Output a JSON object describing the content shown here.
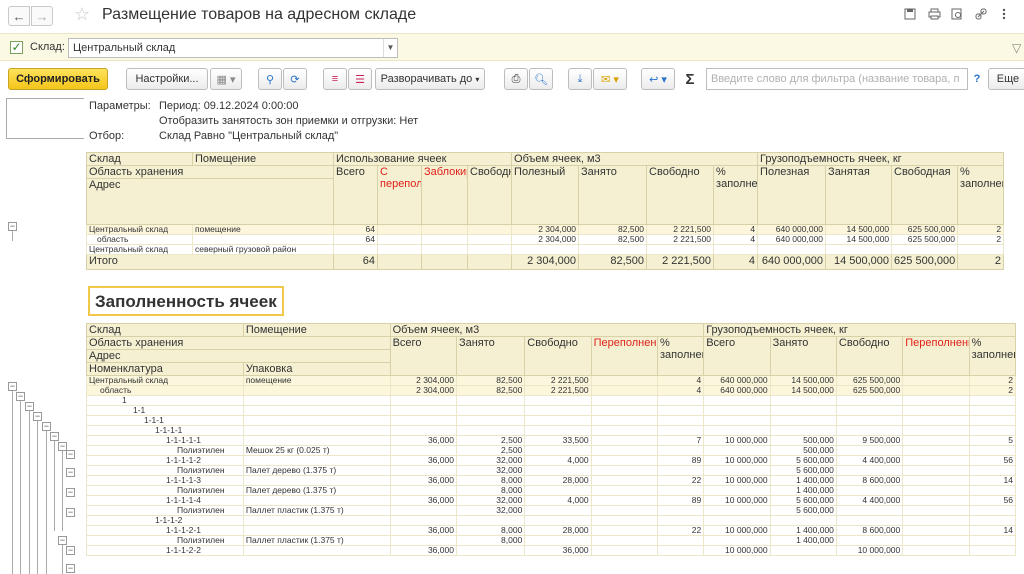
{
  "window": {
    "title": "Размещение товаров на адресном складе",
    "back_icon": "←",
    "forward_icon": "→",
    "star_icon": "☆"
  },
  "filter": {
    "warehouse_label": "Склад:",
    "warehouse_value": "Центральный склад",
    "checked": true
  },
  "toolbar": {
    "generate_label": "Сформировать",
    "settings_label": "Настройки...",
    "expand_label": "Разворачивать до",
    "search_placeholder": "Введите слово для фильтра (название товара, п",
    "help_label": "?",
    "more_label": "Еще"
  },
  "params": {
    "parameters_label": "Параметры:",
    "period": "Период: 09.12.2024 0:00:00",
    "show_zones": "Отобразить занятость зон приемки и отгрузки: Нет",
    "selection_label": "Отбор:",
    "selection_value": "Склад Равно \"Центральный склад\""
  },
  "table1": {
    "h_warehouse": "Склад",
    "h_room": "Помещение",
    "h_cells_use": "Использование ячеек",
    "h_volume": "Объем ячеек, м3",
    "h_capacity": "Грузоподъемность ячеек, кг",
    "h_storage_area": "Область хранения",
    "h_address": "Адрес",
    "h_total": "Всего",
    "h_overfilled": "С переполнением",
    "h_blocked": "Заблокировано",
    "h_free_cells": "Свободных",
    "h_useful": "Полезный",
    "h_occupied": "Занято",
    "h_free": "Свободно",
    "h_percent": "% заполнения",
    "h_useful_cap": "Полезная",
    "h_occupied_cap": "Занятая",
    "h_free_cap": "Свободная",
    "rows": [
      {
        "name": "Центральный склад",
        "room": "помещение",
        "total": "64",
        "useful": "2 304,000",
        "occupied": "82,500",
        "free": "2 221,500",
        "pct": "4",
        "cap_useful": "640 000,000",
        "cap_occ": "14 500,000",
        "cap_free": "625 500,000",
        "cap_pct": "2"
      },
      {
        "name": "область",
        "room": "",
        "total": "64",
        "useful": "2 304,000",
        "occupied": "82,500",
        "free": "2 221,500",
        "pct": "4",
        "cap_useful": "640 000,000",
        "cap_occ": "14 500,000",
        "cap_free": "625 500,000",
        "cap_pct": "2"
      },
      {
        "name": "Центральный склад",
        "room": "северный грузовой район",
        "total": "",
        "useful": "",
        "occupied": "",
        "free": "",
        "pct": "",
        "cap_useful": "",
        "cap_occ": "",
        "cap_free": "",
        "cap_pct": ""
      }
    ],
    "total_row": {
      "label": "Итого",
      "total": "64",
      "useful": "2 304,000",
      "occupied": "82,500",
      "free": "2 221,500",
      "pct": "4",
      "cap_useful": "640 000,000",
      "cap_occ": "14 500,000",
      "cap_free": "625 500,000",
      "cap_pct": "2"
    }
  },
  "section_title": "Заполненность ячеек",
  "table2": {
    "h_warehouse": "Склад",
    "h_room": "Помещение",
    "h_volume": "Объем ячеек, м3",
    "h_capacity": "Грузоподъемность ячеек, кг",
    "h_storage_area": "Область хранения",
    "h_address": "Адрес",
    "h_nomenclature": "Номенклатура",
    "h_package": "Упаковка",
    "h_total": "Всего",
    "h_occupied": "Занято",
    "h_free": "Свободно",
    "h_overfill": "Переполнение",
    "h_percent": "% заполнения",
    "rows": [
      {
        "a": "Центральный склад",
        "b": "помещение",
        "indent": 0,
        "v_total": "2 304,000",
        "v_occ": "82,500",
        "v_free": "2 221,500",
        "v_pct": "4",
        "c_total": "640 000,000",
        "c_occ": "14 500,000",
        "c_free": "625 500,000",
        "c_pct": "2",
        "group": true
      },
      {
        "a": "область",
        "b": "",
        "indent": 1,
        "v_total": "2 304,000",
        "v_occ": "82,500",
        "v_free": "2 221,500",
        "v_pct": "4",
        "c_total": "640 000,000",
        "c_occ": "14 500,000",
        "c_free": "625 500,000",
        "c_pct": "2",
        "group": true
      },
      {
        "a": "1",
        "b": "",
        "indent": 3,
        "v_total": "",
        "v_occ": "",
        "v_free": "",
        "v_pct": "",
        "c_total": "",
        "c_occ": "",
        "c_free": "",
        "c_pct": ""
      },
      {
        "a": "1-1",
        "b": "",
        "indent": 4,
        "v_total": "",
        "v_occ": "",
        "v_free": "",
        "v_pct": "",
        "c_total": "",
        "c_occ": "",
        "c_free": "",
        "c_pct": ""
      },
      {
        "a": "1-1-1",
        "b": "",
        "indent": 5,
        "v_total": "",
        "v_occ": "",
        "v_free": "",
        "v_pct": "",
        "c_total": "",
        "c_occ": "",
        "c_free": "",
        "c_pct": ""
      },
      {
        "a": "1-1-1-1",
        "b": "",
        "indent": 6,
        "v_total": "",
        "v_occ": "",
        "v_free": "",
        "v_pct": "",
        "c_total": "",
        "c_occ": "",
        "c_free": "",
        "c_pct": ""
      },
      {
        "a": "1-1-1-1-1",
        "b": "",
        "indent": 7,
        "v_total": "36,000",
        "v_occ": "2,500",
        "v_free": "33,500",
        "v_pct": "7",
        "c_total": "10 000,000",
        "c_occ": "500,000",
        "c_free": "9 500,000",
        "c_pct": "5"
      },
      {
        "a": "Полиэтилен",
        "b": "Мешок 25 кг (0.025 т)",
        "indent": 8,
        "v_total": "",
        "v_occ": "2,500",
        "v_free": "",
        "v_pct": "",
        "c_total": "",
        "c_occ": "500,000",
        "c_free": "",
        "c_pct": ""
      },
      {
        "a": "1-1-1-1-2",
        "b": "",
        "indent": 7,
        "v_total": "36,000",
        "v_occ": "32,000",
        "v_free": "4,000",
        "v_pct": "89",
        "c_total": "10 000,000",
        "c_occ": "5 600,000",
        "c_free": "4 400,000",
        "c_pct": "56"
      },
      {
        "a": "Полиэтилен",
        "b": "Палет дерево (1.375 т)",
        "indent": 8,
        "v_total": "",
        "v_occ": "32,000",
        "v_free": "",
        "v_pct": "",
        "c_total": "",
        "c_occ": "5 600,000",
        "c_free": "",
        "c_pct": ""
      },
      {
        "a": "1-1-1-1-3",
        "b": "",
        "indent": 7,
        "v_total": "36,000",
        "v_occ": "8,000",
        "v_free": "28,000",
        "v_pct": "22",
        "c_total": "10 000,000",
        "c_occ": "1 400,000",
        "c_free": "8 600,000",
        "c_pct": "14"
      },
      {
        "a": "Полиэтилен",
        "b": "Палет дерево (1.375 т)",
        "indent": 8,
        "v_total": "",
        "v_occ": "8,000",
        "v_free": "",
        "v_pct": "",
        "c_total": "",
        "c_occ": "1 400,000",
        "c_free": "",
        "c_pct": ""
      },
      {
        "a": "1-1-1-1-4",
        "b": "",
        "indent": 7,
        "v_total": "36,000",
        "v_occ": "32,000",
        "v_free": "4,000",
        "v_pct": "89",
        "c_total": "10 000,000",
        "c_occ": "5 600,000",
        "c_free": "4 400,000",
        "c_pct": "56"
      },
      {
        "a": "Полиэтилен",
        "b": "Паллет пластик (1.375 т)",
        "indent": 8,
        "v_total": "",
        "v_occ": "32,000",
        "v_free": "",
        "v_pct": "",
        "c_total": "",
        "c_occ": "5 600,000",
        "c_free": "",
        "c_pct": ""
      },
      {
        "a": "1-1-1-2",
        "b": "",
        "indent": 6,
        "v_total": "",
        "v_occ": "",
        "v_free": "",
        "v_pct": "",
        "c_total": "",
        "c_occ": "",
        "c_free": "",
        "c_pct": ""
      },
      {
        "a": "1-1-1-2-1",
        "b": "",
        "indent": 7,
        "v_total": "36,000",
        "v_occ": "8,000",
        "v_free": "28,000",
        "v_pct": "22",
        "c_total": "10 000,000",
        "c_occ": "1 400,000",
        "c_free": "8 600,000",
        "c_pct": "14"
      },
      {
        "a": "Полиэтилен",
        "b": "Паллет пластик (1.375 т)",
        "indent": 8,
        "v_total": "",
        "v_occ": "8,000",
        "v_free": "",
        "v_pct": "",
        "c_total": "",
        "c_occ": "1 400,000",
        "c_free": "",
        "c_pct": ""
      },
      {
        "a": "1-1-1-2-2",
        "b": "",
        "indent": 7,
        "v_total": "36,000",
        "v_occ": "",
        "v_free": "36,000",
        "v_pct": "",
        "c_total": "10 000,000",
        "c_occ": "",
        "c_free": "10 000,000",
        "c_pct": ""
      }
    ]
  }
}
